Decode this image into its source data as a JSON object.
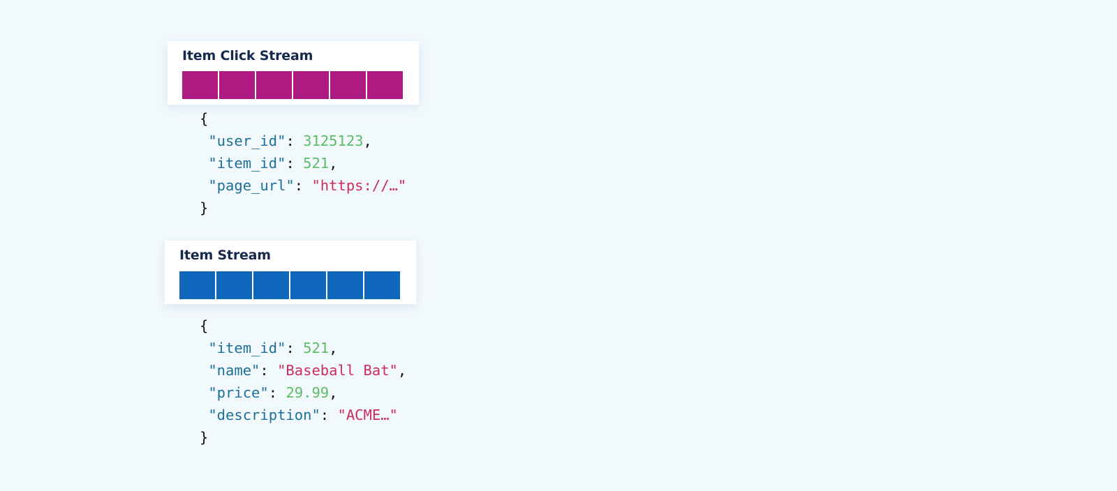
{
  "streams": [
    {
      "title": "Item Click Stream",
      "color": "#ad1a82",
      "cell_count": 6,
      "record": [
        {
          "key": "\"user_id\"",
          "value": "3125123",
          "type": "number",
          "trail": ","
        },
        {
          "key": "\"item_id\"",
          "value": "521",
          "type": "number",
          "trail": ","
        },
        {
          "key": "\"page_url\"",
          "value": "\"https://…\"",
          "type": "string",
          "trail": ""
        }
      ]
    },
    {
      "title": "Item Stream",
      "color": "#0f67bb",
      "cell_count": 6,
      "record": [
        {
          "key": "\"item_id\"",
          "value": "521",
          "type": "number",
          "trail": ","
        },
        {
          "key": "\"name\"",
          "value": "\"Baseball Bat\"",
          "type": "string",
          "trail": ","
        },
        {
          "key": "\"price\"",
          "value": "29.99",
          "type": "number",
          "trail": ","
        },
        {
          "key": "\"description\"",
          "value": "\"ACME…\"",
          "type": "string",
          "trail": ""
        }
      ]
    }
  ],
  "syntax": {
    "open_brace": "{",
    "close_brace": "}",
    "separator": ": "
  }
}
